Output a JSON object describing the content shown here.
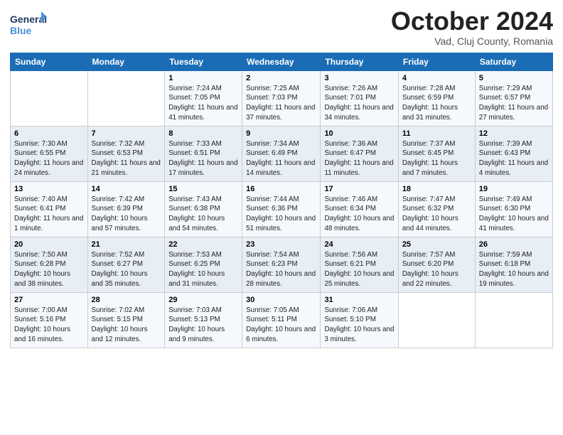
{
  "logo": {
    "line1": "General",
    "line2": "Blue"
  },
  "title": "October 2024",
  "subtitle": "Vad, Cluj County, Romania",
  "headers": [
    "Sunday",
    "Monday",
    "Tuesday",
    "Wednesday",
    "Thursday",
    "Friday",
    "Saturday"
  ],
  "weeks": [
    [
      {
        "num": "",
        "detail": ""
      },
      {
        "num": "",
        "detail": ""
      },
      {
        "num": "1",
        "detail": "Sunrise: 7:24 AM\nSunset: 7:05 PM\nDaylight: 11 hours and 41 minutes."
      },
      {
        "num": "2",
        "detail": "Sunrise: 7:25 AM\nSunset: 7:03 PM\nDaylight: 11 hours and 37 minutes."
      },
      {
        "num": "3",
        "detail": "Sunrise: 7:26 AM\nSunset: 7:01 PM\nDaylight: 11 hours and 34 minutes."
      },
      {
        "num": "4",
        "detail": "Sunrise: 7:28 AM\nSunset: 6:59 PM\nDaylight: 11 hours and 31 minutes."
      },
      {
        "num": "5",
        "detail": "Sunrise: 7:29 AM\nSunset: 6:57 PM\nDaylight: 11 hours and 27 minutes."
      }
    ],
    [
      {
        "num": "6",
        "detail": "Sunrise: 7:30 AM\nSunset: 6:55 PM\nDaylight: 11 hours and 24 minutes."
      },
      {
        "num": "7",
        "detail": "Sunrise: 7:32 AM\nSunset: 6:53 PM\nDaylight: 11 hours and 21 minutes."
      },
      {
        "num": "8",
        "detail": "Sunrise: 7:33 AM\nSunset: 6:51 PM\nDaylight: 11 hours and 17 minutes."
      },
      {
        "num": "9",
        "detail": "Sunrise: 7:34 AM\nSunset: 6:49 PM\nDaylight: 11 hours and 14 minutes."
      },
      {
        "num": "10",
        "detail": "Sunrise: 7:36 AM\nSunset: 6:47 PM\nDaylight: 11 hours and 11 minutes."
      },
      {
        "num": "11",
        "detail": "Sunrise: 7:37 AM\nSunset: 6:45 PM\nDaylight: 11 hours and 7 minutes."
      },
      {
        "num": "12",
        "detail": "Sunrise: 7:39 AM\nSunset: 6:43 PM\nDaylight: 11 hours and 4 minutes."
      }
    ],
    [
      {
        "num": "13",
        "detail": "Sunrise: 7:40 AM\nSunset: 6:41 PM\nDaylight: 11 hours and 1 minute."
      },
      {
        "num": "14",
        "detail": "Sunrise: 7:42 AM\nSunset: 6:39 PM\nDaylight: 10 hours and 57 minutes."
      },
      {
        "num": "15",
        "detail": "Sunrise: 7:43 AM\nSunset: 6:38 PM\nDaylight: 10 hours and 54 minutes."
      },
      {
        "num": "16",
        "detail": "Sunrise: 7:44 AM\nSunset: 6:36 PM\nDaylight: 10 hours and 51 minutes."
      },
      {
        "num": "17",
        "detail": "Sunrise: 7:46 AM\nSunset: 6:34 PM\nDaylight: 10 hours and 48 minutes."
      },
      {
        "num": "18",
        "detail": "Sunrise: 7:47 AM\nSunset: 6:32 PM\nDaylight: 10 hours and 44 minutes."
      },
      {
        "num": "19",
        "detail": "Sunrise: 7:49 AM\nSunset: 6:30 PM\nDaylight: 10 hours and 41 minutes."
      }
    ],
    [
      {
        "num": "20",
        "detail": "Sunrise: 7:50 AM\nSunset: 6:28 PM\nDaylight: 10 hours and 38 minutes."
      },
      {
        "num": "21",
        "detail": "Sunrise: 7:52 AM\nSunset: 6:27 PM\nDaylight: 10 hours and 35 minutes."
      },
      {
        "num": "22",
        "detail": "Sunrise: 7:53 AM\nSunset: 6:25 PM\nDaylight: 10 hours and 31 minutes."
      },
      {
        "num": "23",
        "detail": "Sunrise: 7:54 AM\nSunset: 6:23 PM\nDaylight: 10 hours and 28 minutes."
      },
      {
        "num": "24",
        "detail": "Sunrise: 7:56 AM\nSunset: 6:21 PM\nDaylight: 10 hours and 25 minutes."
      },
      {
        "num": "25",
        "detail": "Sunrise: 7:57 AM\nSunset: 6:20 PM\nDaylight: 10 hours and 22 minutes."
      },
      {
        "num": "26",
        "detail": "Sunrise: 7:59 AM\nSunset: 6:18 PM\nDaylight: 10 hours and 19 minutes."
      }
    ],
    [
      {
        "num": "27",
        "detail": "Sunrise: 7:00 AM\nSunset: 5:16 PM\nDaylight: 10 hours and 16 minutes."
      },
      {
        "num": "28",
        "detail": "Sunrise: 7:02 AM\nSunset: 5:15 PM\nDaylight: 10 hours and 12 minutes."
      },
      {
        "num": "29",
        "detail": "Sunrise: 7:03 AM\nSunset: 5:13 PM\nDaylight: 10 hours and 9 minutes."
      },
      {
        "num": "30",
        "detail": "Sunrise: 7:05 AM\nSunset: 5:11 PM\nDaylight: 10 hours and 6 minutes."
      },
      {
        "num": "31",
        "detail": "Sunrise: 7:06 AM\nSunset: 5:10 PM\nDaylight: 10 hours and 3 minutes."
      },
      {
        "num": "",
        "detail": ""
      },
      {
        "num": "",
        "detail": ""
      }
    ]
  ]
}
